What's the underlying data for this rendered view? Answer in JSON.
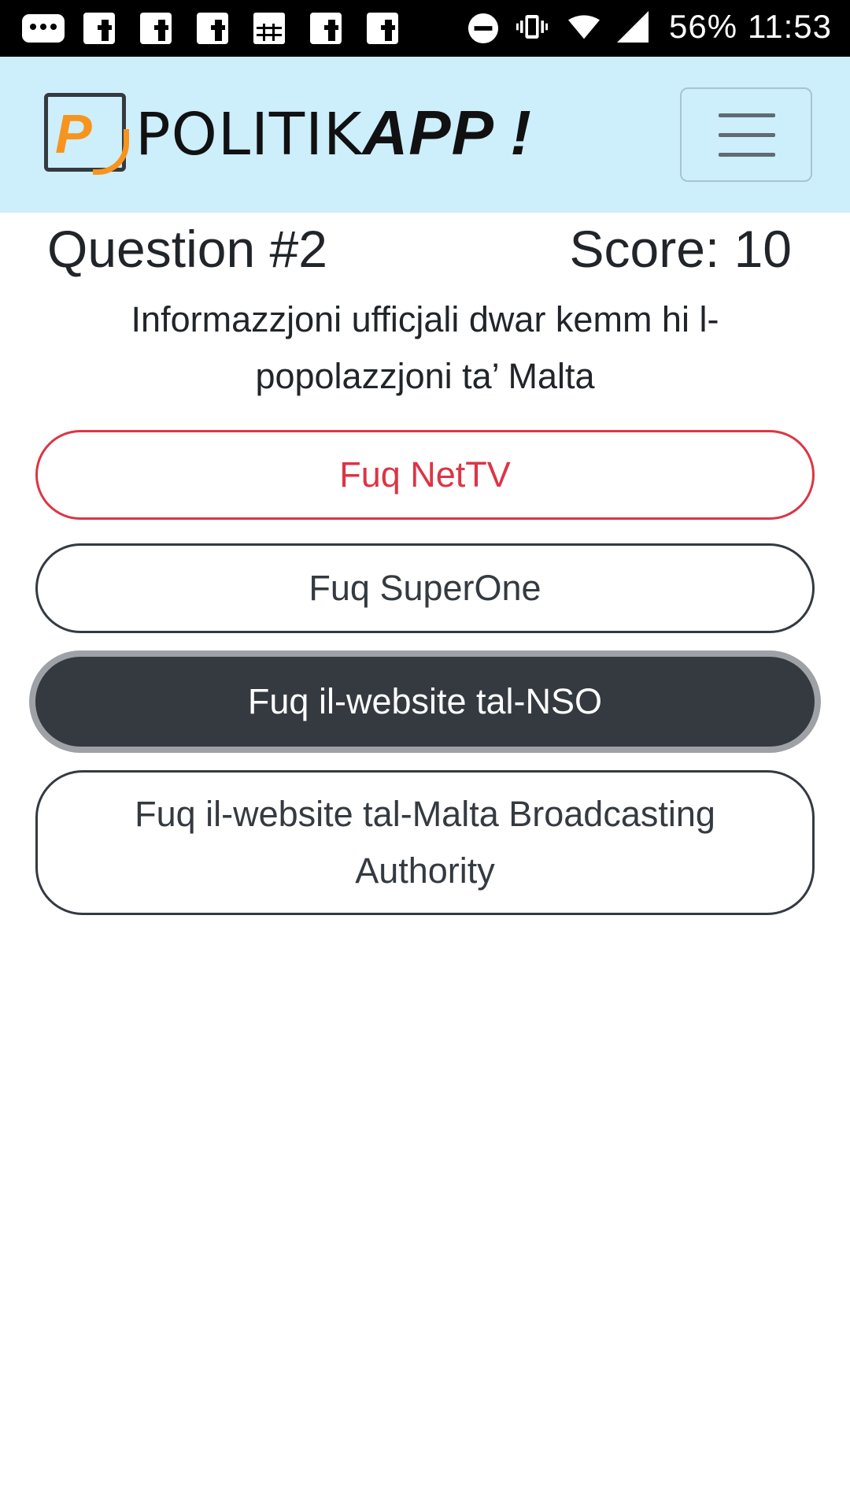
{
  "status_bar": {
    "battery": "56%",
    "time": "11:53",
    "icons": [
      "message-icon",
      "facebook-icon",
      "facebook-icon",
      "facebook-icon",
      "grid-icon",
      "facebook-icon",
      "facebook-icon",
      "do-not-disturb-icon",
      "vibrate-icon",
      "wifi-icon",
      "signal-icon"
    ]
  },
  "navbar": {
    "brand_light": "POLITIK",
    "brand_bold": "APP !",
    "logo_letter": "P",
    "menu_icon": "hamburger-icon"
  },
  "quiz": {
    "question_label": "Question #2",
    "score_label": "Score: 10",
    "question_text": "Informazzjoni ufficjali dwar kemm hi l-popolazzjoni ta’ Malta",
    "answers": [
      {
        "label": "Fuq NetTV",
        "state": "wrong"
      },
      {
        "label": "Fuq SuperOne",
        "state": "default"
      },
      {
        "label": "Fuq il-website tal-NSO",
        "state": "selected"
      },
      {
        "label": "Fuq il-website tal-Malta Broadcasting Authority",
        "state": "default"
      }
    ]
  },
  "colors": {
    "navbar_bg": "#cdeefb",
    "accent_orange": "#f7941d",
    "wrong_red": "#dc3545",
    "dark": "#343a40"
  }
}
